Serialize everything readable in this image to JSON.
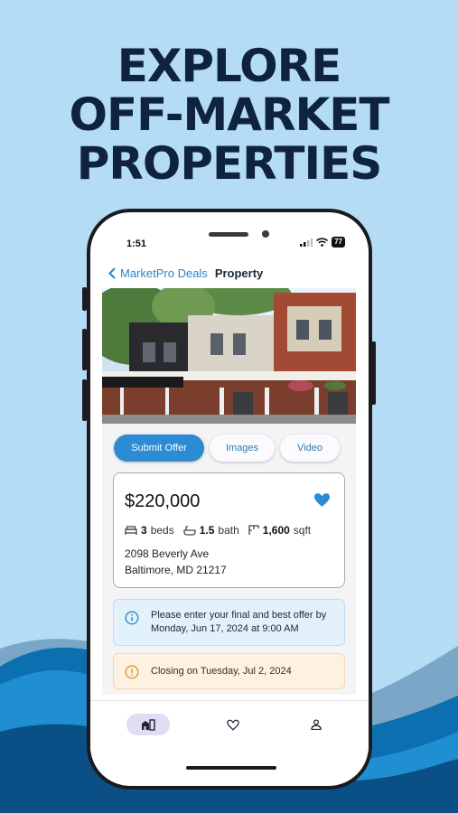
{
  "headline": {
    "line1": "EXPLORE",
    "line2": "OFF-MARKET",
    "line3": "PROPERTIES"
  },
  "status_bar": {
    "time": "1:51",
    "battery": "77"
  },
  "nav": {
    "back_label": "MarketPro Deals",
    "title": "Property"
  },
  "tabs": [
    {
      "label": "Submit Offer",
      "active": true
    },
    {
      "label": "Images",
      "active": false
    },
    {
      "label": "Video",
      "active": false
    }
  ],
  "listing": {
    "price": "$220,000",
    "favorited": true,
    "beds": "3",
    "beds_label": "beds",
    "baths": "1.5",
    "baths_label": "bath",
    "sqft": "1,600",
    "sqft_label": "sqft",
    "address_line1": "2098 Beverly Ave",
    "address_line2": "Baltimore, MD 21217"
  },
  "notices": {
    "info": "Please enter your final and best offer by Monday, Jun 17, 2024 at 9:00 AM",
    "warning": "Closing on Tuesday, Jul 2, 2024"
  },
  "bottom_nav": [
    "home-icon",
    "heart-icon",
    "profile-icon"
  ],
  "colors": {
    "accent": "#2b8bd3",
    "headline": "#0f2340",
    "background": "#b5dcf5",
    "heart": "#2b8bd3"
  }
}
